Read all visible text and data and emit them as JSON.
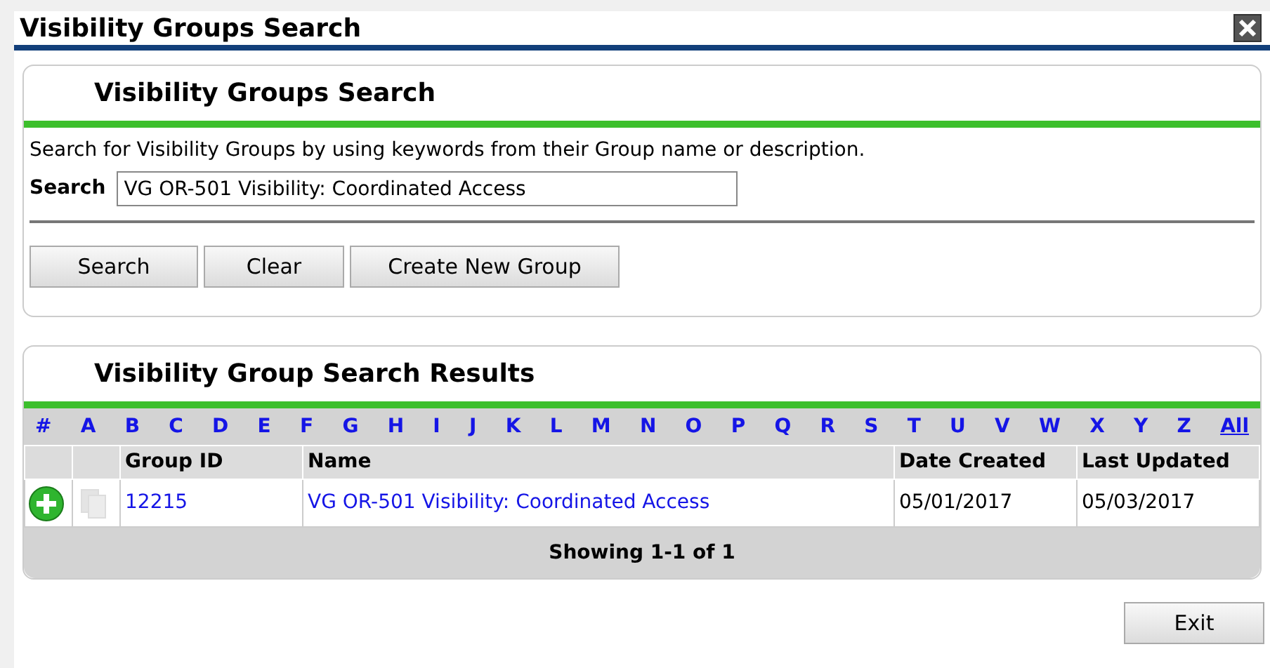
{
  "window": {
    "title": "Visibility Groups Search"
  },
  "search_panel": {
    "title": "Visibility Groups Search",
    "instructions": "Search for Visibility Groups by using keywords from their Group name or description.",
    "search_label": "Search",
    "search_value": "VG OR-501 Visibility: Coordinated Access",
    "buttons": [
      "Search",
      "Clear",
      "Create New Group"
    ]
  },
  "results_panel": {
    "title": "Visibility Group Search Results",
    "letters": [
      "#",
      "A",
      "B",
      "C",
      "D",
      "E",
      "F",
      "G",
      "H",
      "I",
      "J",
      "K",
      "L",
      "M",
      "N",
      "O",
      "P",
      "Q",
      "R",
      "S",
      "T",
      "U",
      "V",
      "W",
      "X",
      "Y",
      "Z"
    ],
    "all_link": "All",
    "columns": [
      "Group ID",
      "Name",
      "Date Created",
      "Last Updated"
    ],
    "rows": [
      {
        "group_id": "12215",
        "name": "VG OR-501 Visibility: Coordinated Access",
        "date_created": "05/01/2017",
        "last_updated": "05/03/2017"
      }
    ],
    "footer": "Showing 1-1 of 1"
  },
  "exit_button": "Exit"
}
